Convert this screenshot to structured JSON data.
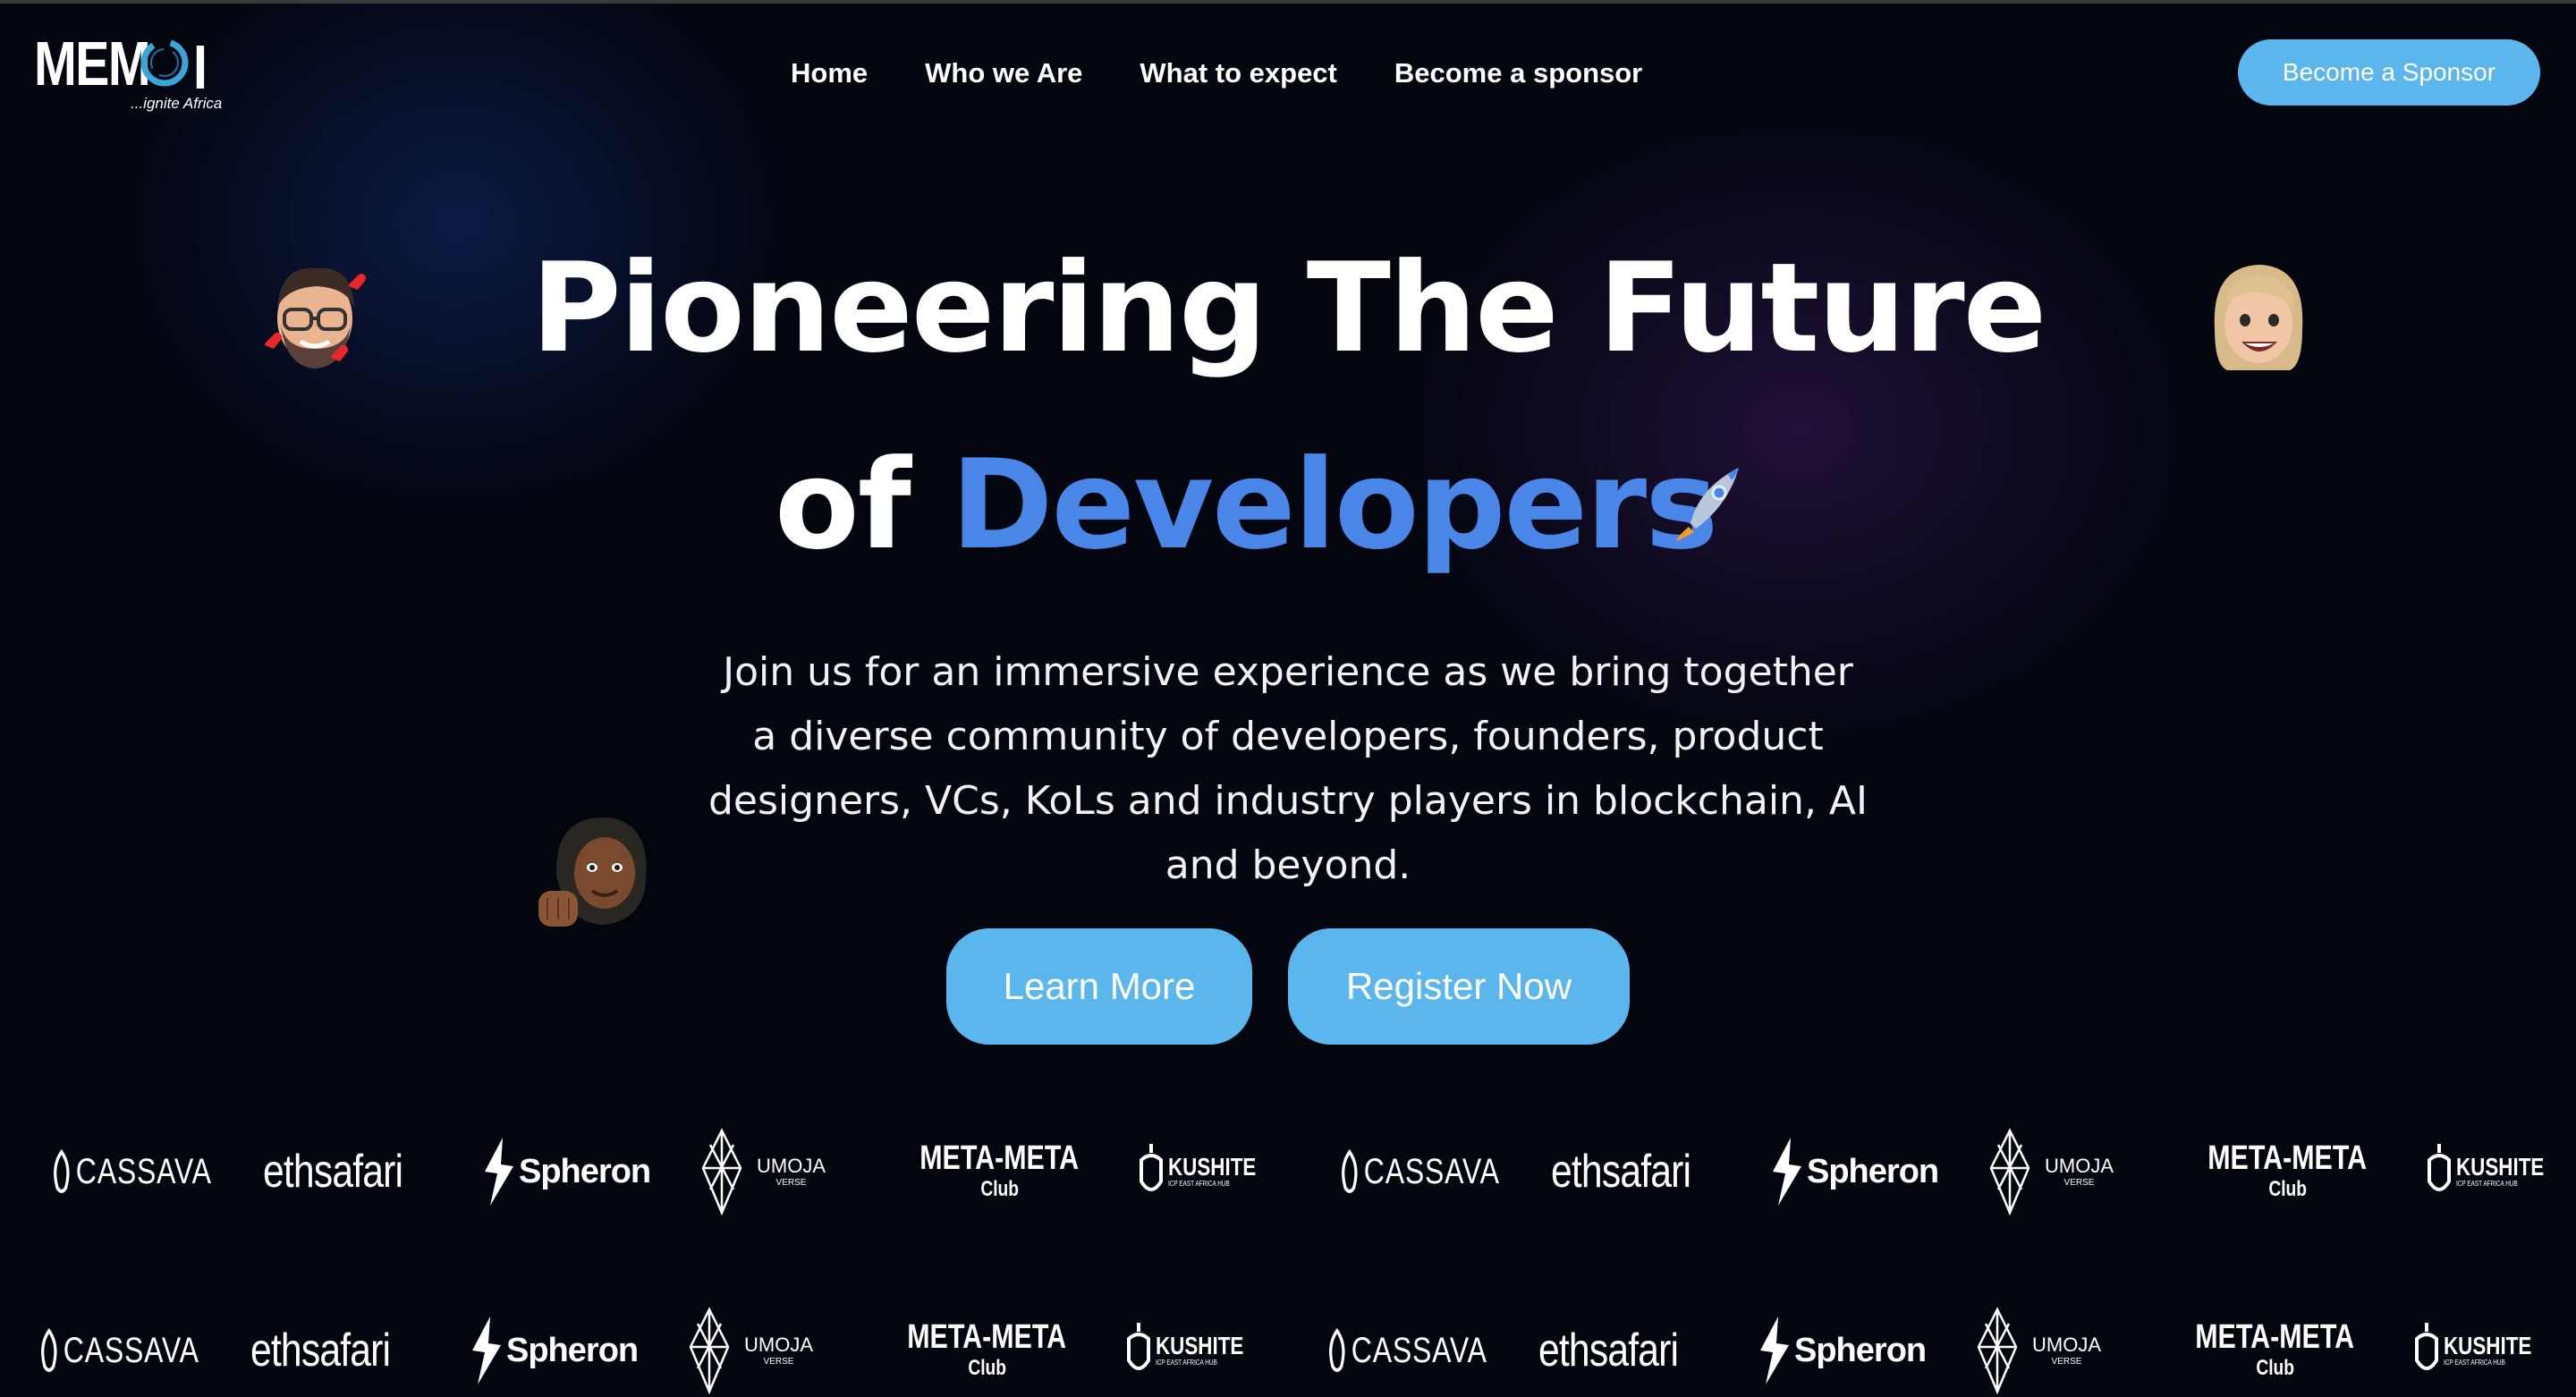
{
  "header": {
    "logo": {
      "name": "MEMOI",
      "tagline": "...ignite Africa"
    },
    "nav": [
      {
        "label": "Home"
      },
      {
        "label": "Who we Are"
      },
      {
        "label": "What to expect"
      },
      {
        "label": "Become a sponsor"
      }
    ],
    "cta_label": "Become a Sponsor"
  },
  "hero": {
    "title_line1": "Pioneering The Future",
    "title_line2_prefix": "of",
    "title_line2_accent": "Developers",
    "subtitle": "Join us for an immersive experience as we bring together a diverse community of developers, founders, product designers, VCs, KoLs and industry players in blockchain, AI and beyond.",
    "learn_more_label": "Learn More",
    "register_label": "Register Now"
  },
  "sponsors": [
    {
      "name": "CASSAVA"
    },
    {
      "name": "ethsafari"
    },
    {
      "name": "Spheron"
    },
    {
      "name": "UMOJA",
      "sub": "VERSE"
    },
    {
      "name": "META-META",
      "sub": "Club"
    },
    {
      "name": "KUSHITE",
      "sub": "ICP EAST AFRICA HUB"
    }
  ],
  "colors": {
    "background": "#03060f",
    "accent_blue": "#4a86e8",
    "button_blue": "#5bb6ee"
  }
}
